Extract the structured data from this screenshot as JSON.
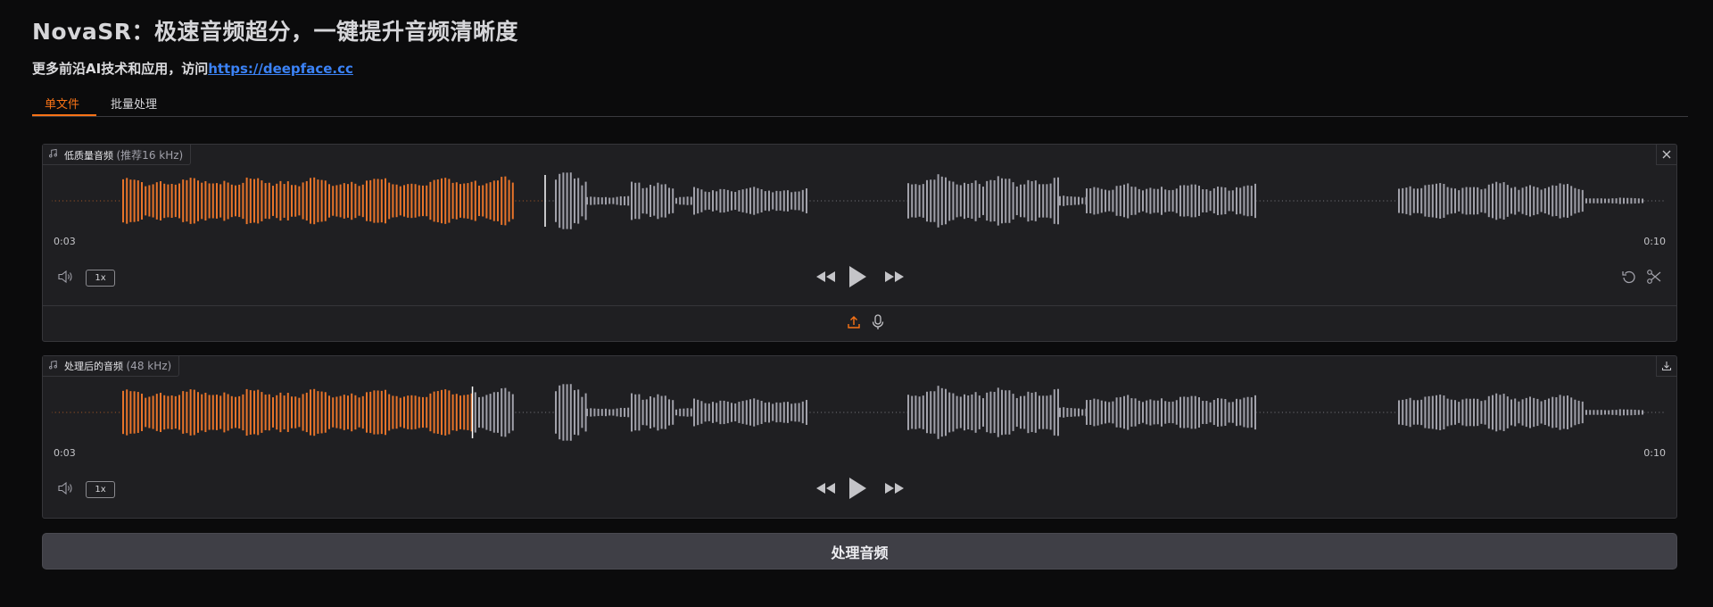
{
  "header": {
    "title": "NovaSR：极速音频超分，一键提升音频清晰度",
    "subtitle_text": "更多前沿AI技术和应用，访问",
    "subtitle_link": "https://deepface.cc"
  },
  "tabs": [
    {
      "label": "单文件",
      "active": true
    },
    {
      "label": "批量处理",
      "active": false
    }
  ],
  "input_audio": {
    "label": "低质量音频",
    "label_note": "(推荐16 kHz)",
    "current_time": "0:03",
    "duration": "0:10",
    "speed": "1x",
    "progress": 0.3
  },
  "output_audio": {
    "label": "处理后的音频",
    "label_note": "(48 kHz)",
    "current_time": "0:03",
    "duration": "0:10",
    "speed": "1x",
    "progress": 0.255
  },
  "process_button": "处理音频",
  "colors": {
    "accent": "#f97316",
    "wave_played": "#e8742a",
    "wave_unplayed": "#a1a1aa",
    "link": "#3b82f6",
    "background": "#0b0b0c",
    "panel": "#1f1f22"
  },
  "icons": [
    "music-note-icon",
    "close-icon",
    "volume-icon",
    "rewind-icon",
    "play-icon",
    "fast-forward-icon",
    "undo-icon",
    "scissors-icon",
    "upload-icon",
    "microphone-icon",
    "download-icon"
  ]
}
